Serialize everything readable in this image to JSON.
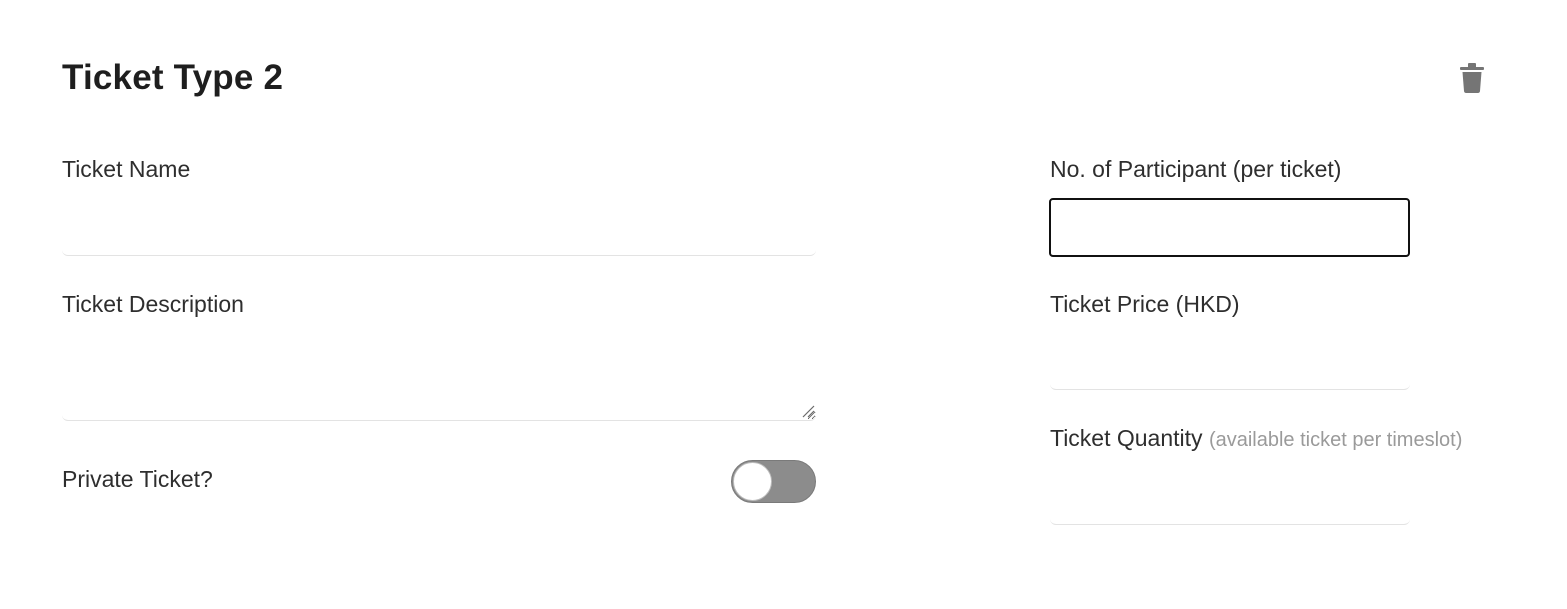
{
  "card": {
    "title": "Ticket Type 2",
    "delete_icon": "trash-icon"
  },
  "fields": {
    "ticket_name": {
      "label": "Ticket Name",
      "value": ""
    },
    "ticket_description": {
      "label": "Ticket Description",
      "value": ""
    },
    "private_ticket": {
      "label": "Private Ticket?",
      "on": false
    },
    "participants": {
      "label": "No. of Participant (per ticket)",
      "value": ""
    },
    "ticket_price": {
      "label": "Ticket Price (HKD)",
      "value": ""
    },
    "ticket_quantity": {
      "label": "Ticket Quantity",
      "hint": "(available ticket per timeslot)",
      "value": ""
    }
  },
  "colors": {
    "toggle_off": "#8c8c8c",
    "icon": "#757575",
    "focus_border": "#111111"
  }
}
